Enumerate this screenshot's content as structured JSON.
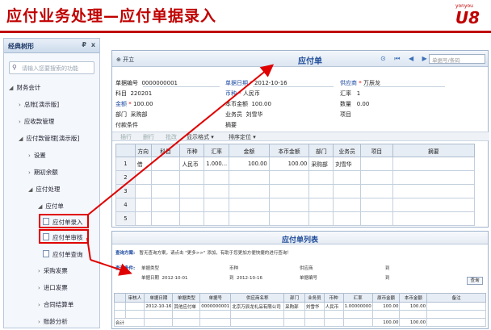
{
  "slide_title": "应付业务处理—应付单据录入",
  "logo": {
    "small": "yonyou",
    "big": "U8"
  },
  "left_panel": {
    "title": "经典树形",
    "pin": "₽",
    "close": "x",
    "search_placeholder": "请输入您要搜索的功能",
    "items": [
      "财务会计",
      "总账[演示版]",
      "应收款管理",
      "应付款管理[演示版]",
      "设置",
      "期初余额",
      "应付处理",
      "应付单",
      "应付单录入",
      "应付单审核",
      "应付单查询",
      "采购发票",
      "进口发票",
      "合同结算单",
      "账龄分析"
    ]
  },
  "voucher": {
    "toolbar_open": "开立",
    "title": "应付单",
    "nav_icons": "⊙ ⏮ ◀ ▶ ⏭",
    "search_placeholder": "单据号/条码",
    "fields": {
      "doc_no_label": "单据编号",
      "doc_no": "0000000001",
      "date_label": "单据日期",
      "date": "2012-10-16",
      "supplier_label": "供应商",
      "supplier": "万辰龙",
      "subject_label": "科目",
      "subject": "220201",
      "currency_label": "币种",
      "currency": "人民币",
      "rate_label": "汇率",
      "rate": "1",
      "amount_label": "金额",
      "amount": "100.00",
      "local_amount_label": "本币金额",
      "local_amount": "100.00",
      "qty_label": "数量",
      "qty": "0.00",
      "dept_label": "部门",
      "dept": "采购部",
      "clerk_label": "业务员",
      "clerk": "刘雪华",
      "project_label": "项目",
      "project": "",
      "pay_terms_label": "付款条件",
      "pay_terms": "",
      "summary_label": "摘要",
      "summary": ""
    },
    "actions": [
      "插行",
      "删行",
      "批改",
      "显示格式 ▾",
      "排序定位 ▾"
    ],
    "columns": [
      "",
      "方向",
      "科目",
      "币种",
      "汇率",
      "金额",
      "本币金额",
      "部门",
      "业务员",
      "项目",
      "摘要"
    ],
    "rows": [
      [
        "1",
        "借",
        "",
        "人民币",
        "1.000...",
        "100.00",
        "100.00",
        "采购部",
        "刘雪华",
        "",
        ""
      ],
      [
        "2",
        "",
        "",
        "",
        "",
        "",
        "",
        "",
        "",
        "",
        ""
      ],
      [
        "3",
        "",
        "",
        "",
        "",
        "",
        "",
        "",
        "",
        "",
        ""
      ],
      [
        "4",
        "",
        "",
        "",
        "",
        "",
        "",
        "",
        "",
        "",
        ""
      ],
      [
        "5",
        "",
        "",
        "",
        "",
        "",
        "",
        "",
        "",
        "",
        ""
      ]
    ]
  },
  "list_window": {
    "title": "应付单列表",
    "query_plan_label": "查询方案:",
    "query_plan_hint": "暂无查询方案，请点击 \"更多>>\" 添加，有助于您更加方便快捷的进行查询！",
    "query_cond_label": "查询条件:",
    "doc_type_label": "单据类型",
    "currency_label": "币种",
    "supplier_label": "供应商",
    "to_label": "到",
    "doc_date_label": "单据日期",
    "date_from": "2012-10-01",
    "date_to": "2012-10-16",
    "doc_no_label": "单据编号",
    "query_btn": "查询",
    "columns": [
      "",
      "审核人",
      "单据日期",
      "单据类型",
      "单据号",
      "供应商名称",
      "部门",
      "业务员",
      "币种",
      "汇率",
      "原币金额",
      "本币金额",
      "备注"
    ],
    "rows": [
      [
        "",
        "",
        "2012-10-16",
        "其他应付单",
        "0000000001",
        "北京万辰龙礼品有限公司",
        "采购部",
        "刘雪华",
        "人民币",
        "1.00000000",
        "100.00",
        "100.00",
        ""
      ]
    ],
    "total_row": [
      "合计",
      "",
      "",
      "",
      "",
      "",
      "",
      "",
      "",
      "",
      "100.00",
      "100.00",
      ""
    ]
  },
  "colors": {
    "title_red": "#c00000",
    "arrow_red": "#e00000",
    "header_blue": "#1e4c9a"
  }
}
